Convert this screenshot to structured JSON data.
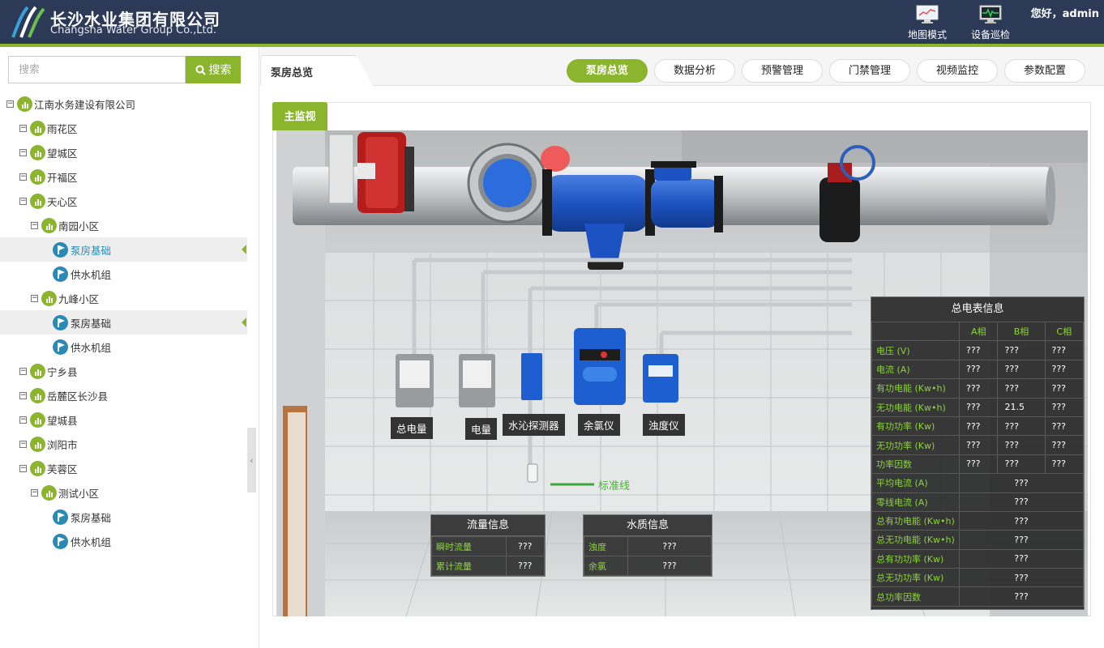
{
  "header": {
    "company_cn": "长沙水业集团有限公司",
    "company_en": "Changsha Water Group Co.,Ltd.",
    "map_mode_label": "地图模式",
    "inspection_label": "设备巡检",
    "greeting": "您好，admin"
  },
  "sidebar": {
    "search_placeholder": "搜索",
    "search_button": "搜索",
    "tree": [
      {
        "label": "江南水务建设有限公司",
        "type": "node",
        "level": 0,
        "toggle": "⊟"
      },
      {
        "label": "雨花区",
        "type": "node",
        "level": 1,
        "toggle": "⊟"
      },
      {
        "label": "望城区",
        "type": "node",
        "level": 1,
        "toggle": "⊟"
      },
      {
        "label": "开福区",
        "type": "node",
        "level": 1,
        "toggle": "⊟"
      },
      {
        "label": "天心区",
        "type": "node",
        "level": 1,
        "toggle": "⊟"
      },
      {
        "label": "南园小区",
        "type": "node",
        "level": 2,
        "toggle": "⊟"
      },
      {
        "label": "泵房基础",
        "type": "leaf",
        "level": 3,
        "selected": true
      },
      {
        "label": "供水机组",
        "type": "leaf",
        "level": 3
      },
      {
        "label": "九峰小区",
        "type": "node",
        "level": 2,
        "toggle": "⊟"
      },
      {
        "label": "泵房基础",
        "type": "leaf",
        "level": 3,
        "selected": true,
        "muted": true
      },
      {
        "label": "供水机组",
        "type": "leaf",
        "level": 3
      },
      {
        "label": "宁乡县",
        "type": "node",
        "level": 1,
        "toggle": "⊟"
      },
      {
        "label": "岳麓区长沙县",
        "type": "node",
        "level": 1,
        "toggle": "⊟"
      },
      {
        "label": "望城县",
        "type": "node",
        "level": 1,
        "toggle": "⊟"
      },
      {
        "label": "浏阳市",
        "type": "node",
        "level": 1,
        "toggle": "⊟"
      },
      {
        "label": "芙蓉区",
        "type": "node",
        "level": 1,
        "toggle": "⊟"
      },
      {
        "label": "测试小区",
        "type": "node",
        "level": 2,
        "toggle": "⊟"
      },
      {
        "label": "泵房基础",
        "type": "leaf",
        "level": 3
      },
      {
        "label": "供水机组",
        "type": "leaf",
        "level": 3
      }
    ]
  },
  "main": {
    "page_tab": "泵房总览",
    "nav": [
      "泵房总览",
      "数据分析",
      "预警管理",
      "门禁管理",
      "视频监控",
      "参数配置"
    ],
    "active_nav": "泵房总览",
    "panel_tab": "主监视"
  },
  "scene": {
    "devices": [
      "总电量",
      "电量",
      "水沁探测器",
      "余氯仪",
      "浊度仪"
    ],
    "standard_line": "标准线",
    "flow": {
      "title": "流量信息",
      "rows": [
        {
          "label": "瞬时流量",
          "value": "???"
        },
        {
          "label": "累计流量",
          "value": "???"
        }
      ]
    },
    "water_quality": {
      "title": "水质信息",
      "rows": [
        {
          "label": "浊度",
          "value": "???"
        },
        {
          "label": "余氯",
          "value": "???"
        }
      ]
    },
    "meter": {
      "title": "总电表信息",
      "phase_headers": [
        "A相",
        "B相",
        "C相"
      ],
      "phase_rows": [
        {
          "label": "电压 (V)",
          "a": "???",
          "b": "???",
          "c": "???"
        },
        {
          "label": "电流 (A)",
          "a": "???",
          "b": "???",
          "c": "???"
        },
        {
          "label": "有功电能 (Kw•h)",
          "a": "???",
          "b": "???",
          "c": "???"
        },
        {
          "label": "无功电能 (Kw•h)",
          "a": "???",
          "b": "21.5",
          "c": "???"
        },
        {
          "label": "有功功率 (Kw)",
          "a": "???",
          "b": "???",
          "c": "???"
        },
        {
          "label": "无功功率 (Kw)",
          "a": "???",
          "b": "???",
          "c": "???"
        },
        {
          "label": "功率因数",
          "a": "???",
          "b": "???",
          "c": "???"
        }
      ],
      "total_rows": [
        {
          "label": "平均电流 (A)",
          "value": "???"
        },
        {
          "label": "零线电流 (A)",
          "value": "???"
        },
        {
          "label": "总有功电能 (Kw•h)",
          "value": "???"
        },
        {
          "label": "总无功电能 (Kw•h)",
          "value": "???"
        },
        {
          "label": "总有功功率 (Kw)",
          "value": "???"
        },
        {
          "label": "总无功功率 (Kw)",
          "value": "???"
        },
        {
          "label": "总功率因数",
          "value": "???"
        }
      ]
    }
  },
  "colors": {
    "header_bg": "#2c3a58",
    "accent_green": "#8ab52c",
    "leaf_blue": "#2a8ab5",
    "data_label_green": "#8bd43c"
  }
}
